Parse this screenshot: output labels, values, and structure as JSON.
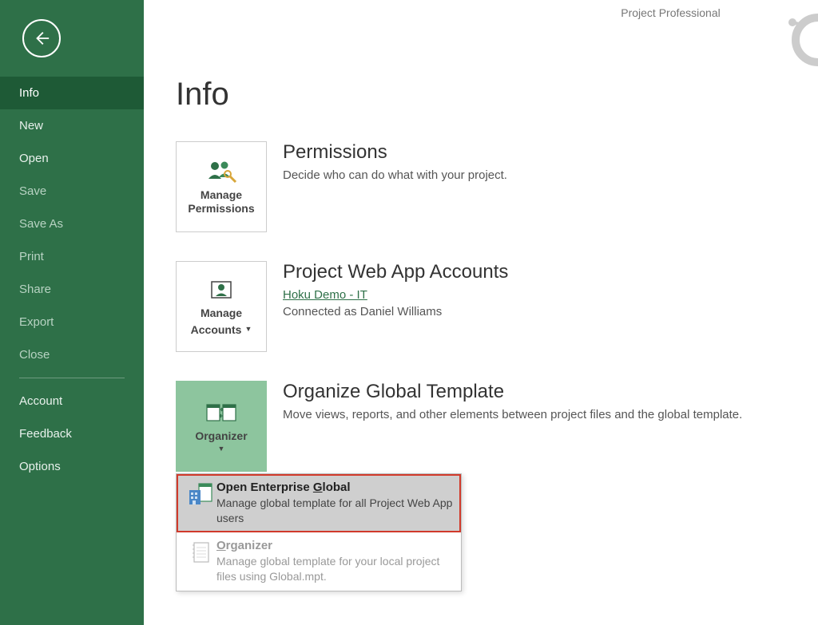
{
  "app_title": "Project Professional",
  "page_title": "Info",
  "sidebar": {
    "items": [
      {
        "label": "Info",
        "active": true
      },
      {
        "label": "New"
      },
      {
        "label": "Open"
      },
      {
        "label": "Save",
        "dim": true
      },
      {
        "label": "Save As",
        "dim": true
      },
      {
        "label": "Print",
        "dim": true
      },
      {
        "label": "Share",
        "dim": true
      },
      {
        "label": "Export",
        "dim": true
      },
      {
        "label": "Close",
        "dim": true
      }
    ],
    "footer": [
      {
        "label": "Account"
      },
      {
        "label": "Feedback"
      },
      {
        "label": "Options"
      }
    ]
  },
  "sections": {
    "permissions": {
      "tile_line1": "Manage",
      "tile_line2": "Permissions",
      "heading": "Permissions",
      "body": "Decide who can do what with your project."
    },
    "accounts": {
      "tile_line1": "Manage",
      "tile_line2": "Accounts",
      "heading": "Project Web App Accounts",
      "link": "Hoku Demo - IT",
      "body": "Connected as Daniel Williams"
    },
    "organize": {
      "tile_line1": "Organizer",
      "heading": "Organize Global Template",
      "body": "Move views, reports, and other elements between project files and the global template."
    }
  },
  "dropdown": {
    "item1": {
      "title_pre": "Open Enterprise ",
      "title_ul": "G",
      "title_post": "lobal",
      "desc": "Manage global template for all Project Web App users"
    },
    "item2": {
      "title_ul": "O",
      "title_post": "rganizer",
      "desc": "Manage global template for your local project files using Global.mpt."
    }
  }
}
